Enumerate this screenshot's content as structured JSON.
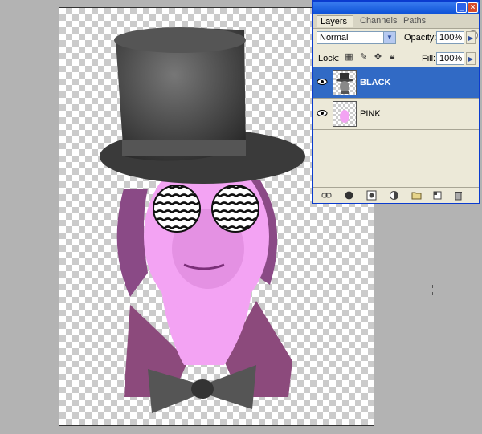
{
  "document": {
    "name": "artwork-canvas"
  },
  "palette": {
    "tabs": [
      {
        "label": "Layers"
      },
      {
        "label": "Channels"
      },
      {
        "label": "Paths"
      }
    ],
    "blend_mode": "Normal",
    "opacity_label": "Opacity:",
    "opacity_value": "100%",
    "lock_label": "Lock:",
    "fill_label": "Fill:",
    "fill_value": "100%",
    "layers": [
      {
        "name": "BLACK",
        "selected": true,
        "visible": true
      },
      {
        "name": "PINK",
        "selected": false,
        "visible": true
      }
    ],
    "bottom_icons": [
      "link-icon",
      "layer-style-icon",
      "layer-mask-icon",
      "adjustment-layer-icon",
      "new-group-icon",
      "new-layer-icon",
      "trash-icon"
    ]
  },
  "colors": {
    "pink": "#f3a3f3",
    "selection": "#316ac5",
    "titlebar": "#0a4fd6"
  },
  "window_controls": {
    "minimize": "_",
    "close": "×"
  }
}
